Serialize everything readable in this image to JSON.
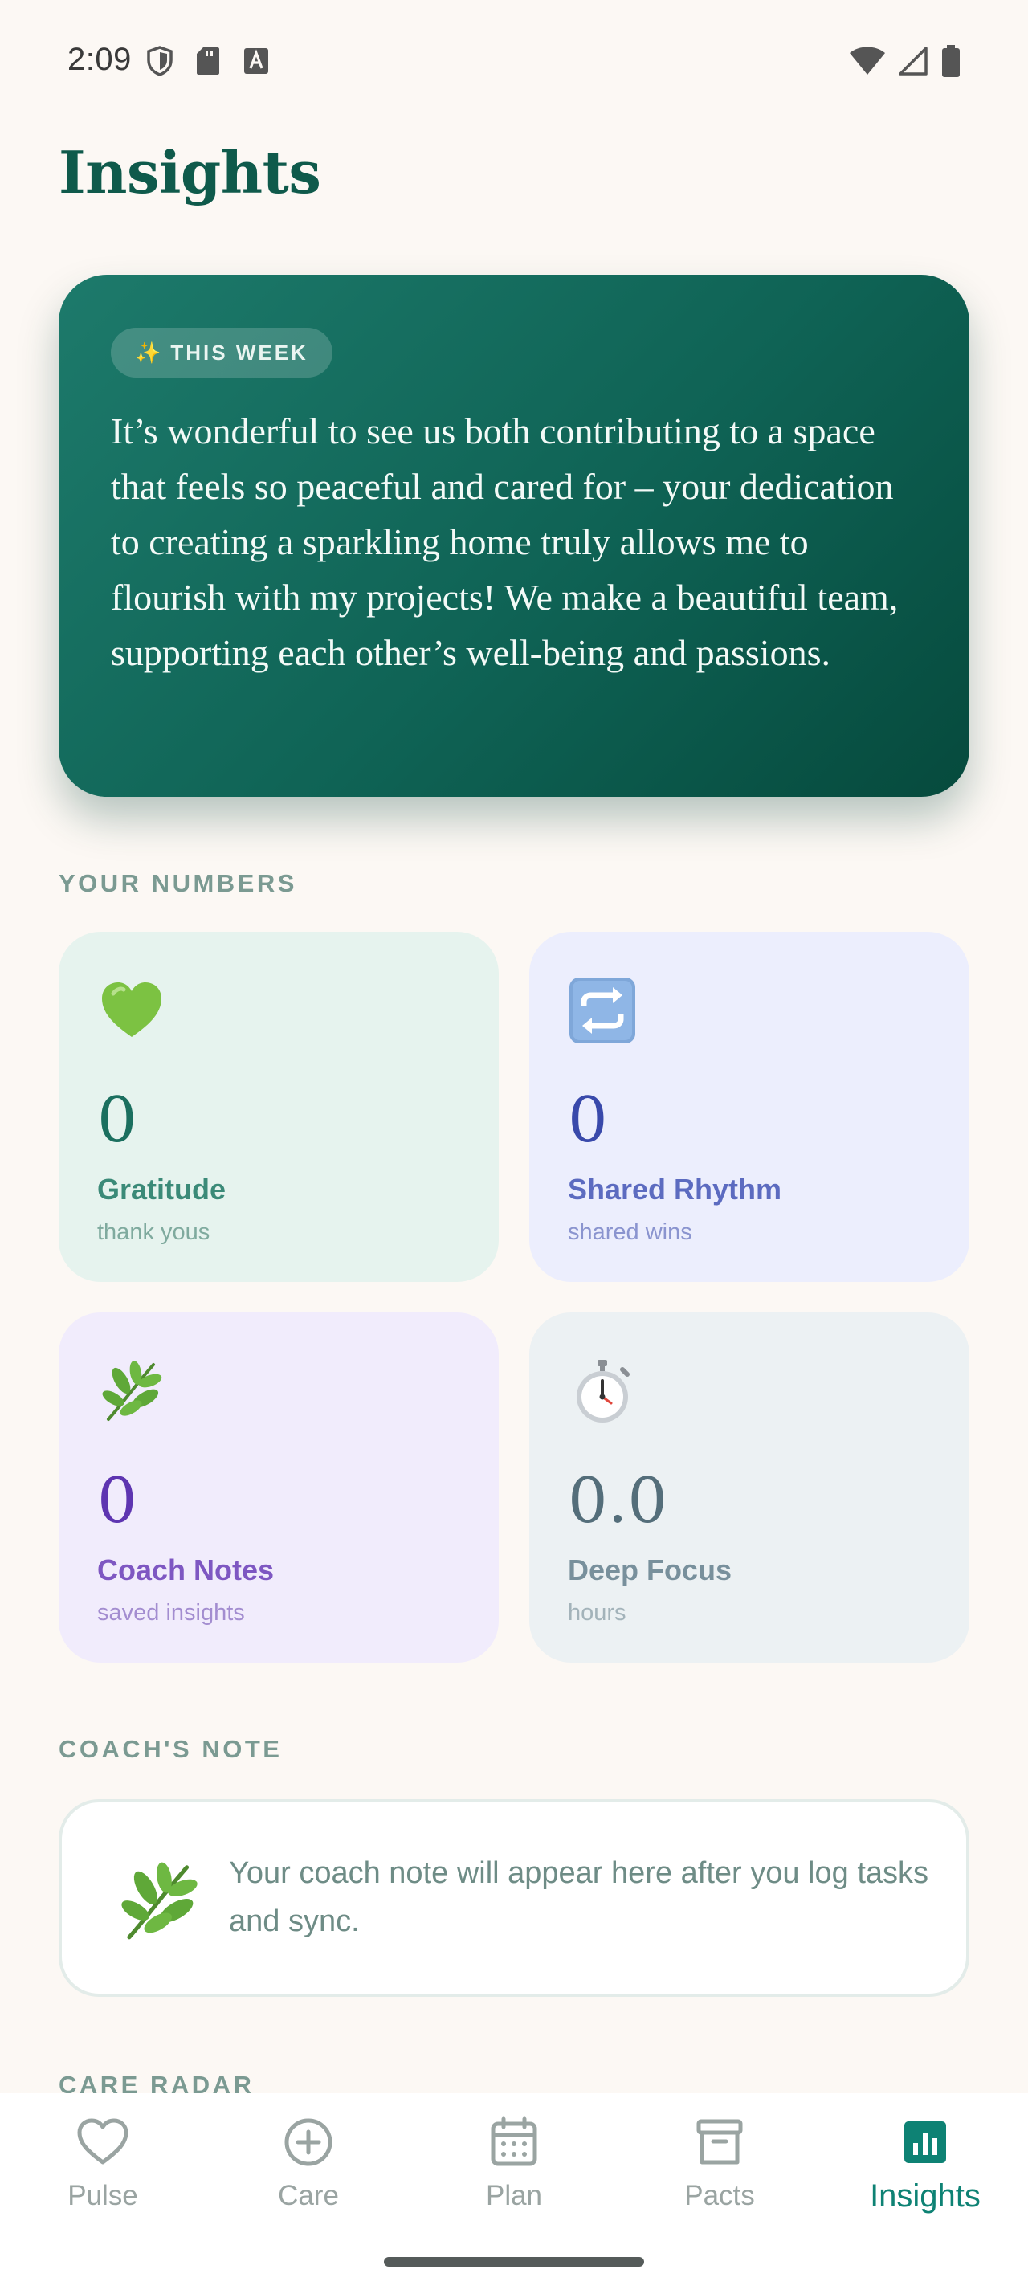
{
  "status_bar": {
    "time": "2:09"
  },
  "page": {
    "title": "Insights"
  },
  "hero": {
    "chip_icon": "✨",
    "chip_label": "THIS WEEK",
    "message": "It’s wonderful to see us both contributing to a space that feels so peaceful and cared for – your dedication to creating a sparkling home truly allows me to flourish with my projects! We make a beautiful team, supporting each other’s well-being and passions."
  },
  "sections": {
    "numbers": "YOUR NUMBERS",
    "coach": "COACH'S NOTE",
    "radar": "CARE RADAR"
  },
  "stats": [
    {
      "icon": "💚",
      "icon_name": "green-heart-icon",
      "value": "0",
      "label": "Gratitude",
      "sub": "thank yous"
    },
    {
      "icon": "🔄",
      "icon_name": "repeat-arrows-icon",
      "value": "0",
      "label": "Shared Rhythm",
      "sub": "shared wins"
    },
    {
      "icon": "🌿",
      "icon_name": "herb-leaf-icon",
      "value": "0",
      "label": "Coach Notes",
      "sub": "saved insights"
    },
    {
      "icon": "⏱️",
      "icon_name": "stopwatch-icon",
      "value": "0.0",
      "label": "Deep Focus",
      "sub": "hours"
    }
  ],
  "coach_note": {
    "text": "Your coach note will appear here after you log tasks and sync."
  },
  "bottom_nav": {
    "items": [
      {
        "label": "Pulse",
        "icon": "heart-outline-icon",
        "active": false
      },
      {
        "label": "Care",
        "icon": "plus-circle-icon",
        "active": false
      },
      {
        "label": "Plan",
        "icon": "calendar-icon",
        "active": false
      },
      {
        "label": "Pacts",
        "icon": "archive-box-icon",
        "active": false
      },
      {
        "label": "Insights",
        "icon": "bar-chart-icon",
        "active": true
      }
    ]
  },
  "colors": {
    "brand": "#0F5A4B",
    "hero_gradient_start": "#1D7A6B",
    "hero_gradient_end": "#064A3D",
    "nav_active": "#0E8274",
    "nav_inactive": "#9AA4A2"
  }
}
